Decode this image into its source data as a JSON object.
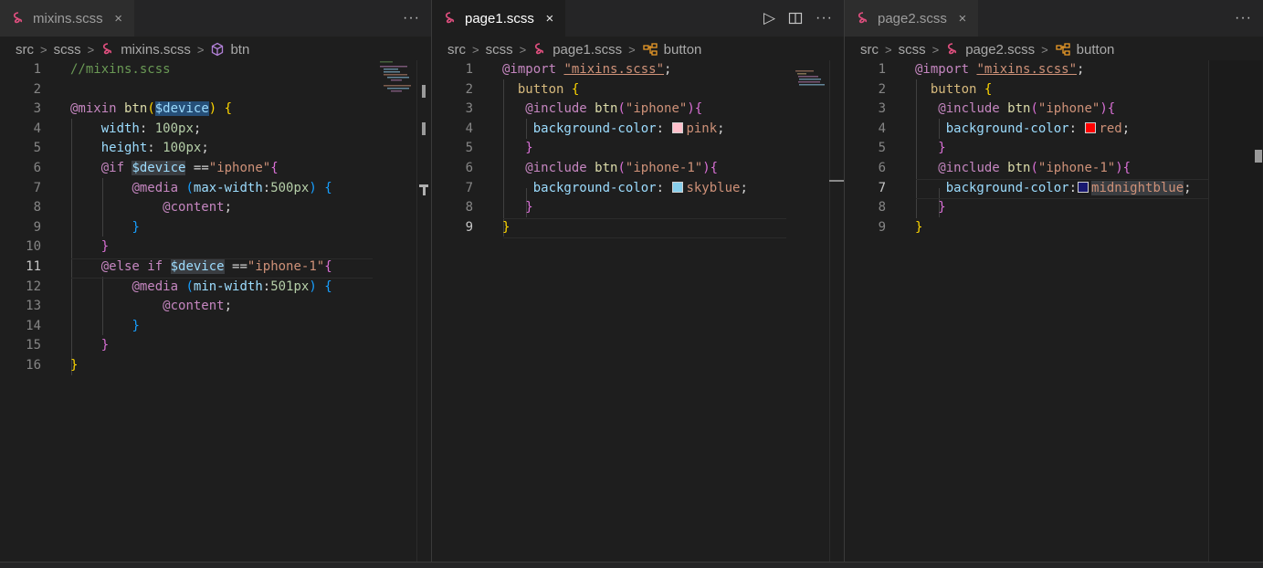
{
  "panes": [
    {
      "tab": {
        "label": "mixins.scss",
        "close": "×",
        "active": false
      },
      "actions": {
        "more": "···"
      },
      "breadcrumb": {
        "parts": [
          "src",
          "scss",
          "mixins.scss",
          "btn"
        ],
        "sep": ">"
      },
      "lines": [
        {
          "n": "1",
          "code": "//mixins.scss"
        },
        {
          "n": "2",
          "code": ""
        },
        {
          "n": "3",
          "code": "@mixin btn($device) {"
        },
        {
          "n": "4",
          "code": "    width: 100px;"
        },
        {
          "n": "5",
          "code": "    height: 100px;"
        },
        {
          "n": "6",
          "code": "    @if $device ==\"iphone\"{"
        },
        {
          "n": "7",
          "code": "        @media (max-width:500px) {"
        },
        {
          "n": "8",
          "code": "            @content;"
        },
        {
          "n": "9",
          "code": "        }"
        },
        {
          "n": "10",
          "code": "    }"
        },
        {
          "n": "11",
          "code": "    @else if $device ==\"iphone-1\"{"
        },
        {
          "n": "12",
          "code": "        @media (min-width:501px) {"
        },
        {
          "n": "13",
          "code": "            @content;"
        },
        {
          "n": "14",
          "code": "        }"
        },
        {
          "n": "15",
          "code": "    }"
        },
        {
          "n": "16",
          "code": "}"
        }
      ]
    },
    {
      "tab": {
        "label": "page1.scss",
        "close": "×",
        "active": true
      },
      "actions": {
        "run": "▷",
        "split": "split-editor-icon",
        "more": "···"
      },
      "breadcrumb": {
        "parts": [
          "src",
          "scss",
          "page1.scss",
          "button"
        ],
        "sep": ">"
      },
      "lines": [
        {
          "n": "1",
          "code": "@import \"mixins.scss\";"
        },
        {
          "n": "2",
          "code": "  button {"
        },
        {
          "n": "3",
          "code": "   @include btn(\"iphone\"){"
        },
        {
          "n": "4",
          "code": "    background-color: pink;"
        },
        {
          "n": "5",
          "code": "   }"
        },
        {
          "n": "6",
          "code": "   @include btn(\"iphone-1\"){"
        },
        {
          "n": "7",
          "code": "    background-color: skyblue;"
        },
        {
          "n": "8",
          "code": "   }"
        },
        {
          "n": "9",
          "code": "}"
        }
      ]
    },
    {
      "tab": {
        "label": "page2.scss",
        "close": "×",
        "active": false
      },
      "actions": {
        "more": "···"
      },
      "breadcrumb": {
        "parts": [
          "src",
          "scss",
          "page2.scss",
          "button"
        ],
        "sep": ">"
      },
      "lines": [
        {
          "n": "1",
          "code": "@import \"mixins.scss\";"
        },
        {
          "n": "2",
          "code": "  button {"
        },
        {
          "n": "3",
          "code": "   @include btn(\"iphone\"){"
        },
        {
          "n": "4",
          "code": "    background-color: red;"
        },
        {
          "n": "5",
          "code": "   }"
        },
        {
          "n": "6",
          "code": "   @include btn(\"iphone-1\"){"
        },
        {
          "n": "7",
          "code": "    background-color:midnightblue;"
        },
        {
          "n": "8",
          "code": "   }"
        },
        {
          "n": "9",
          "code": "}"
        }
      ]
    }
  ],
  "colors": {
    "pink": "#ffc0cb",
    "skyblue": "#87ceeb",
    "red": "#ff0000",
    "midnightblue": "#191970",
    "sass_icon": "#e04f7f",
    "symbol_icon": "#b180d7"
  }
}
